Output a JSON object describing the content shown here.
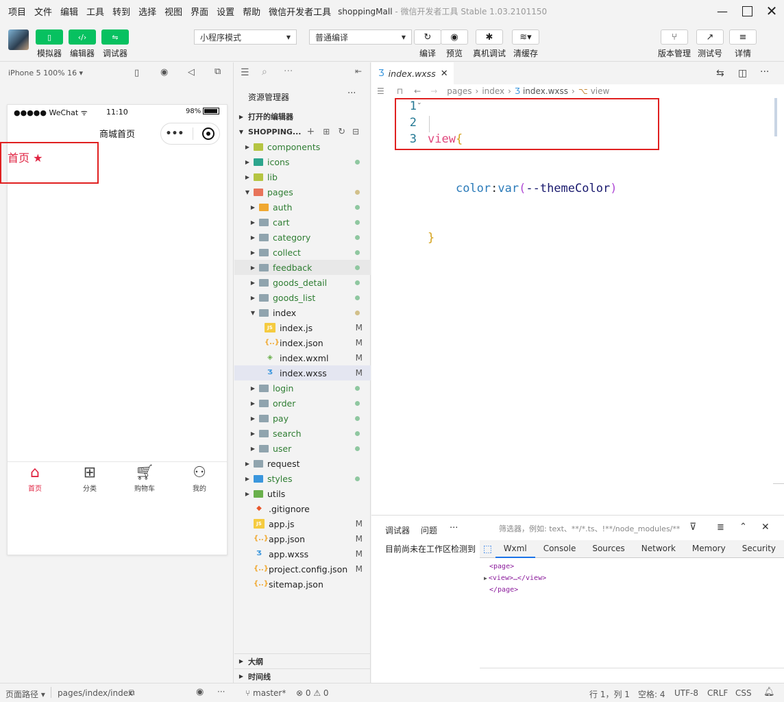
{
  "menu": [
    "项目",
    "文件",
    "编辑",
    "工具",
    "转到",
    "选择",
    "视图",
    "界面",
    "设置",
    "帮助",
    "微信开发者工具"
  ],
  "window_title": "shoppingMall",
  "window_subtitle": "- 微信开发者工具 Stable 1.03.2101150",
  "toolbar": {
    "simulator": "模拟器",
    "editor": "编辑器",
    "debugger": "调试器",
    "mode_select": "小程序模式",
    "compile_select": "普通编译",
    "compile": "编译",
    "preview": "预览",
    "real_debug": "真机调试",
    "clear_cache": "清缓存",
    "version": "版本管理",
    "test_no": "测试号",
    "details": "详情"
  },
  "sim": {
    "device": "iPhone 5 100% 16 ▾",
    "carrier": "●●●●● WeChat",
    "time": "11:10",
    "battery": "98%",
    "nav_title": "商城首页",
    "content_text": "首页",
    "tabs": [
      {
        "label": "首页",
        "active": true
      },
      {
        "label": "分类",
        "active": false
      },
      {
        "label": "购物车",
        "active": false
      },
      {
        "label": "我的",
        "active": false
      }
    ]
  },
  "explorer": {
    "header": "资源管理器",
    "open_editors": "打开的编辑器",
    "project": "SHOPPING...",
    "outline": "大纲",
    "timeline": "时间线",
    "tree": [
      {
        "name": "components",
        "depth": 1,
        "type": "folder",
        "color": "#b5c542",
        "dot": false,
        "status": ""
      },
      {
        "name": "icons",
        "depth": 1,
        "type": "folder",
        "color": "#2ca58d",
        "dot": true,
        "status": ""
      },
      {
        "name": "lib",
        "depth": 1,
        "type": "folder",
        "color": "#b5c542",
        "dot": false,
        "status": ""
      },
      {
        "name": "pages",
        "depth": 1,
        "type": "folder-open",
        "color": "#e8745a",
        "dot": true,
        "dotc": "#d2c08a",
        "status": ""
      },
      {
        "name": "auth",
        "depth": 2,
        "type": "folder",
        "color": "#f0a830",
        "dot": true,
        "status": ""
      },
      {
        "name": "cart",
        "depth": 2,
        "type": "folder",
        "color": "#90a4ae",
        "dot": true,
        "status": ""
      },
      {
        "name": "category",
        "depth": 2,
        "type": "folder",
        "color": "#90a4ae",
        "dot": true,
        "status": ""
      },
      {
        "name": "collect",
        "depth": 2,
        "type": "folder",
        "color": "#90a4ae",
        "dot": true,
        "status": ""
      },
      {
        "name": "feedback",
        "depth": 2,
        "type": "folder",
        "color": "#90a4ae",
        "dot": true,
        "status": "",
        "hl": true
      },
      {
        "name": "goods_detail",
        "depth": 2,
        "type": "folder",
        "color": "#90a4ae",
        "dot": true,
        "status": ""
      },
      {
        "name": "goods_list",
        "depth": 2,
        "type": "folder",
        "color": "#90a4ae",
        "dot": true,
        "status": ""
      },
      {
        "name": "index",
        "depth": 2,
        "type": "folder-open",
        "color": "#90a4ae",
        "dot": true,
        "dotc": "#d2c08a",
        "status": "",
        "plain": true
      },
      {
        "name": "index.js",
        "depth": 3,
        "type": "js",
        "color": "#f0c030",
        "dot": false,
        "status": "M",
        "plain": true
      },
      {
        "name": "index.json",
        "depth": 3,
        "type": "json",
        "color": "#f0a830",
        "dot": false,
        "status": "M",
        "plain": true
      },
      {
        "name": "index.wxml",
        "depth": 3,
        "type": "wxml",
        "color": "#6ab04c",
        "dot": false,
        "status": "M",
        "plain": true
      },
      {
        "name": "index.wxss",
        "depth": 3,
        "type": "wxss",
        "color": "#3a96dd",
        "dot": false,
        "status": "M",
        "plain": true,
        "sel": true
      },
      {
        "name": "login",
        "depth": 2,
        "type": "folder",
        "color": "#90a4ae",
        "dot": true,
        "status": ""
      },
      {
        "name": "order",
        "depth": 2,
        "type": "folder",
        "color": "#90a4ae",
        "dot": true,
        "status": ""
      },
      {
        "name": "pay",
        "depth": 2,
        "type": "folder",
        "color": "#90a4ae",
        "dot": true,
        "status": ""
      },
      {
        "name": "search",
        "depth": 2,
        "type": "folder",
        "color": "#90a4ae",
        "dot": true,
        "status": ""
      },
      {
        "name": "user",
        "depth": 2,
        "type": "folder",
        "color": "#90a4ae",
        "dot": true,
        "status": ""
      },
      {
        "name": "request",
        "depth": 1,
        "type": "folder",
        "color": "#90a4ae",
        "dot": false,
        "status": "",
        "plain": true
      },
      {
        "name": "styles",
        "depth": 1,
        "type": "folder",
        "color": "#3a96dd",
        "dot": true,
        "status": ""
      },
      {
        "name": "utils",
        "depth": 1,
        "type": "folder",
        "color": "#6ab04c",
        "dot": false,
        "status": "",
        "plain": true
      },
      {
        "name": ".gitignore",
        "depth": 1,
        "type": "git",
        "color": "#e8562a",
        "dot": false,
        "status": "",
        "plain": true
      },
      {
        "name": "app.js",
        "depth": 1,
        "type": "js",
        "color": "#f0c030",
        "dot": false,
        "status": "M",
        "plain": true
      },
      {
        "name": "app.json",
        "depth": 1,
        "type": "json",
        "color": "#f0a830",
        "dot": false,
        "status": "M",
        "plain": true
      },
      {
        "name": "app.wxss",
        "depth": 1,
        "type": "wxss",
        "color": "#3a96dd",
        "dot": false,
        "status": "M",
        "plain": true
      },
      {
        "name": "project.config.json",
        "depth": 1,
        "type": "json",
        "color": "#f0a830",
        "dot": false,
        "status": "M",
        "plain": true
      },
      {
        "name": "sitemap.json",
        "depth": 1,
        "type": "json",
        "color": "#f0a830",
        "dot": false,
        "status": "",
        "plain": true
      }
    ]
  },
  "editor": {
    "tab": "index.wxss",
    "breadcrumb": [
      "pages",
      "index",
      "index.wxss",
      "view"
    ],
    "lines": [
      "1",
      "2",
      "3"
    ],
    "code_sel": "view",
    "code_brace_open": "{",
    "code_prop": "color",
    "code_colon": ":",
    "code_fn": "var",
    "code_paren_open": "(",
    "code_var": "--themeColor",
    "code_paren_close": ")",
    "code_brace_close": "}"
  },
  "devtools": {
    "left_tabs": [
      "调试器",
      "问题"
    ],
    "more": "···",
    "filter_placeholder": "筛选器，例如: text、**/*.ts、!**/node_modules/**",
    "left_msg": "目前尚未在工作区检测到",
    "tabs": [
      "Wxml",
      "Console",
      "Sources",
      "Network",
      "Memory",
      "Security"
    ],
    "wxml": [
      "<page>",
      "<view>…</view>",
      "</page>"
    ]
  },
  "status": {
    "page_path_label": "页面路径 ▾",
    "page_path": "pages/index/index",
    "branch": "master*",
    "errors": "⊗ 0 ⚠ 0",
    "position": "行 1，列 1",
    "spaces": "空格: 4",
    "encoding": "UTF-8",
    "eol": "CRLF",
    "lang": "CSS"
  },
  "colors": {
    "accent": "#07c160",
    "tab_active": "#e02442",
    "highlight": "#e02020"
  }
}
